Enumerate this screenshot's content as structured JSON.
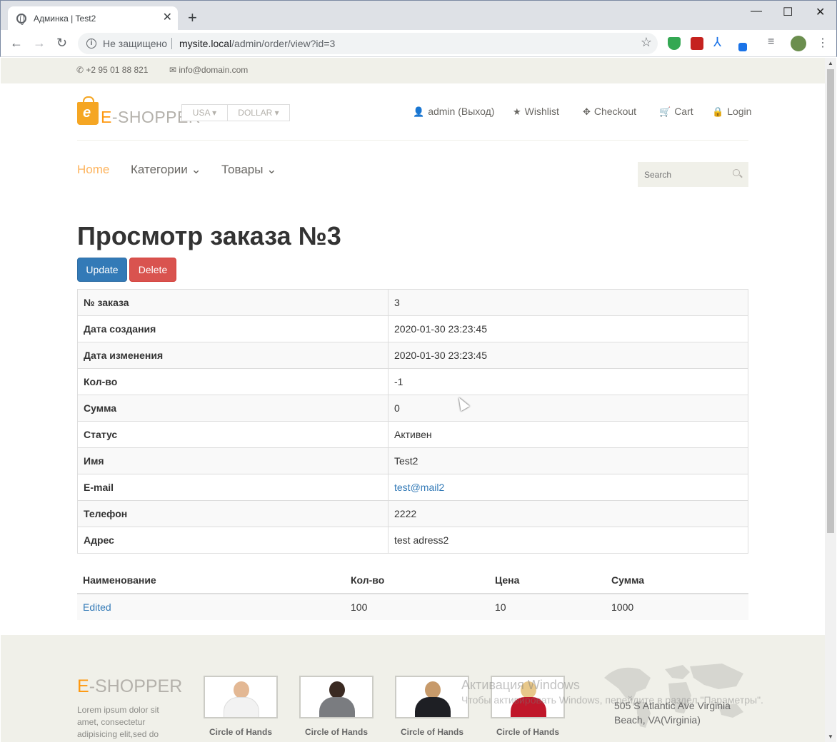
{
  "browser": {
    "tab_title": "Админка | Test2",
    "tab_close": "✕",
    "new_tab": "+",
    "not_secure": "Не защищено",
    "url_host": "mysite.local",
    "url_path": "/admin/order/view?id=3",
    "back": "←",
    "forward": "→",
    "reload": "↻",
    "minimize": "—",
    "maximize": "☐",
    "close": "✕"
  },
  "topbar": {
    "phone": "+2 95 01 88 821",
    "email": "info@domain.com"
  },
  "header": {
    "logo_e": "E",
    "logo_rest": "-SHOPPER",
    "currency_country": "USA",
    "currency_unit": "DOLLAR",
    "menu": {
      "account": "admin (Выход)",
      "wishlist": "Wishlist",
      "checkout": "Checkout",
      "cart": "Cart",
      "login": "Login"
    }
  },
  "nav": {
    "home": "Home",
    "categories": "Категории",
    "products": "Товары",
    "search_placeholder": "Search"
  },
  "main": {
    "title": "Просмотр заказа №3",
    "update_label": "Update",
    "delete_label": "Delete",
    "details": [
      {
        "label": "№ заказа",
        "value": "3"
      },
      {
        "label": "Дата создания",
        "value": "2020-01-30 23:23:45"
      },
      {
        "label": "Дата изменения",
        "value": "2020-01-30 23:23:45"
      },
      {
        "label": "Кол-во",
        "value": "-1"
      },
      {
        "label": "Сумма",
        "value": "0"
      },
      {
        "label": "Статус",
        "value": "Активен"
      },
      {
        "label": "Имя",
        "value": "Test2"
      },
      {
        "label": "E-mail",
        "value": "test@mail2"
      },
      {
        "label": "Телефон",
        "value": "2222"
      },
      {
        "label": "Адрес",
        "value": "test adress2"
      }
    ],
    "items_headers": [
      "Наименование",
      "Кол-во",
      "Цена",
      "Сумма"
    ],
    "items": [
      {
        "name": "Edited",
        "qty": "100",
        "price": "10",
        "sum": "1000"
      }
    ]
  },
  "footer": {
    "logo_e": "E",
    "logo_rest": "-SHOPPER",
    "lorem": "Lorem ipsum dolor sit amet, consectetur adipisicing elit,sed do",
    "videos": [
      {
        "caption": "Circle of Hands"
      },
      {
        "caption": "Circle of Hands"
      },
      {
        "caption": "Circle of Hands"
      },
      {
        "caption": "Circle of Hands"
      }
    ],
    "address_line1": "505 S Atlantic Ave Virginia",
    "address_line2": "Beach, VA(Virginia)",
    "watermark_title": "Активация Windows",
    "watermark_text": "Чтобы активировать Windows, перейдите в раздел \"Параметры\"."
  },
  "colors": {
    "accent": "#fe980f",
    "primary": "#337ab7",
    "danger": "#d9534f",
    "status": "#a94442"
  }
}
